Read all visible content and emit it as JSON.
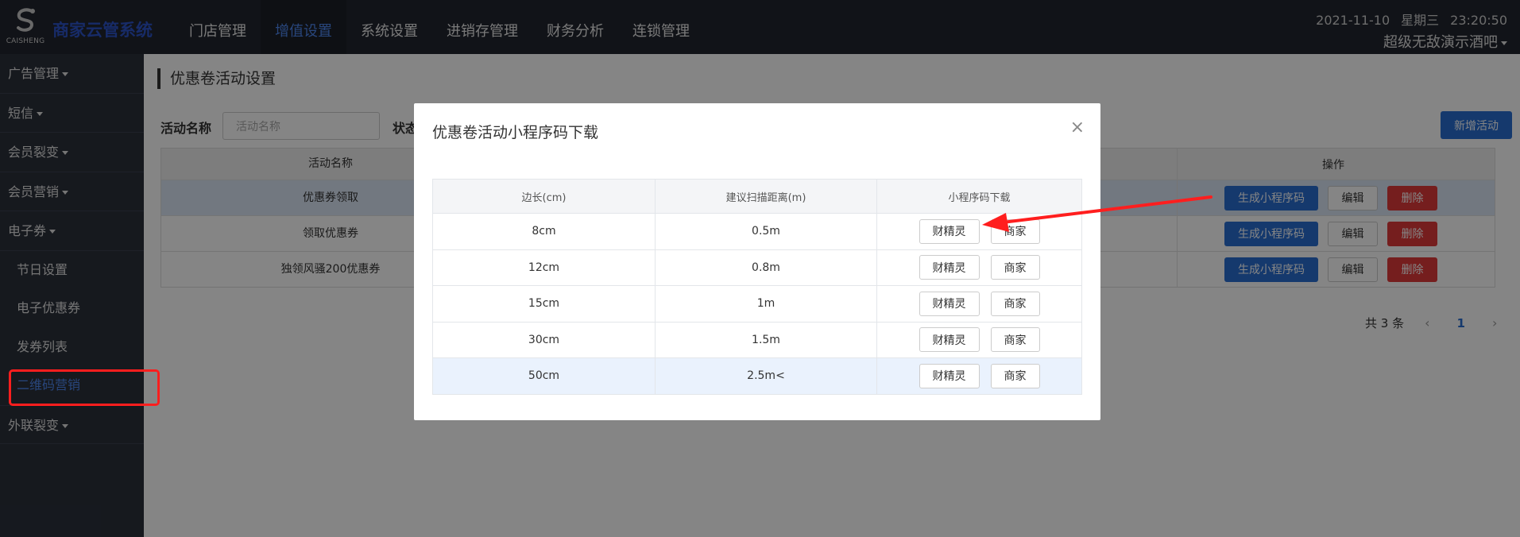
{
  "header": {
    "logo_text": "CAISHENG",
    "system_title": "商家云管系统",
    "nav": [
      {
        "label": "门店管理",
        "active": false
      },
      {
        "label": "增值设置",
        "active": true
      },
      {
        "label": "系统设置",
        "active": false
      },
      {
        "label": "进销存管理",
        "active": false
      },
      {
        "label": "财务分析",
        "active": false
      },
      {
        "label": "连锁管理",
        "active": false
      }
    ],
    "date": "2021-11-10",
    "weekday": "星期三",
    "time": "23:20:50",
    "store_name": "超级无敌演示酒吧"
  },
  "sidebar": {
    "groups": [
      {
        "label": "广告管理"
      },
      {
        "label": "短信"
      },
      {
        "label": "会员裂变"
      },
      {
        "label": "会员营销"
      },
      {
        "label": "电子券"
      }
    ],
    "sub_items": [
      {
        "label": "节日设置"
      },
      {
        "label": "电子优惠券"
      },
      {
        "label": "发券列表"
      },
      {
        "label": "二维码营销",
        "active": true
      }
    ],
    "last_group": {
      "label": "外联裂变"
    }
  },
  "main": {
    "page_title": "优惠卷活动设置",
    "filter": {
      "name_label": "活动名称",
      "name_placeholder": "活动名称",
      "status_label": "状态"
    },
    "add_button": "新增活动",
    "table": {
      "headers": [
        "活动名称",
        "操作"
      ],
      "rows": [
        {
          "name": "优惠券领取",
          "highlight": true
        },
        {
          "name": "领取优惠券",
          "highlight": false
        },
        {
          "name": "独领风骚200优惠券",
          "highlight": false
        }
      ],
      "actions": {
        "generate": "生成小程序码",
        "edit": "编辑",
        "delete": "删除"
      }
    },
    "pagination": {
      "total_text": "共 3 条",
      "current_page": "1",
      "prev": "‹",
      "next": "›"
    }
  },
  "modal": {
    "title": "优惠卷活动小程序码下载",
    "close": "×",
    "headers": [
      "边长(cm)",
      "建议扫描距离(m)",
      "小程序码下载"
    ],
    "rows": [
      {
        "side": "8cm",
        "distance": "0.5m"
      },
      {
        "side": "12cm",
        "distance": "0.8m"
      },
      {
        "side": "15cm",
        "distance": "1m"
      },
      {
        "side": "30cm",
        "distance": "1.5m"
      },
      {
        "side": "50cm",
        "distance": "2.5m<"
      }
    ],
    "btn_a": "财精灵",
    "btn_b": "商家"
  },
  "colors": {
    "accent": "#2a6ed2",
    "danger": "#e03a3a",
    "annotation": "#ff1e1e",
    "sidebar": "#2b303b",
    "topbar": "#22252e"
  }
}
